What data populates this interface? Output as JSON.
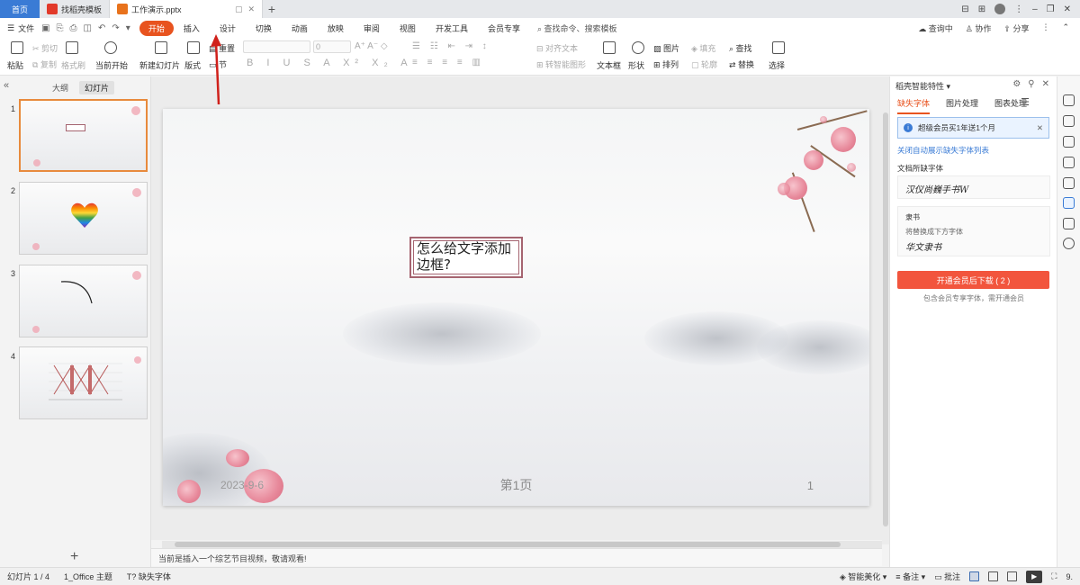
{
  "titlebar": {
    "home_tab": "首页",
    "tabs": [
      {
        "label": "找稻壳模板",
        "icon": "daoke-logo-icon"
      },
      {
        "label": "工作演示.pptx",
        "icon": "presentation-file-icon"
      }
    ],
    "add_tab": "+"
  },
  "menubar": {
    "file_label": "文件",
    "items": [
      "开始",
      "插入",
      "设计",
      "切换",
      "动画",
      "放映",
      "审阅",
      "视图",
      "开发工具",
      "会员专享"
    ],
    "active_item": "开始",
    "search_placeholder": "查找命令、搜索模板",
    "right": {
      "query": "查询中",
      "collab": "协作",
      "share": "分享"
    }
  },
  "ribbon": {
    "paste": "粘贴",
    "cut": "剪切",
    "copy": "复制",
    "format_painter": "格式刷",
    "from_current": "当前开始",
    "new_slide": "新建幻灯片",
    "layout": "版式",
    "section": "节",
    "reset": "重置",
    "font_size": "0",
    "align_text": "对齐文本",
    "smart_shape": "转智能图形",
    "textbox": "文本框",
    "shape": "形状",
    "picture": "图片",
    "fill": "填充",
    "arrange": "排列",
    "outline": "轮廓",
    "find": "查找",
    "replace": "替换",
    "select": "选择"
  },
  "left_panel": {
    "tabs": [
      "大纲",
      "幻灯片"
    ],
    "active_tab": "幻灯片",
    "thumbnails": [
      {
        "number": "1",
        "selected": true
      },
      {
        "number": "2",
        "selected": false
      },
      {
        "number": "3",
        "selected": false
      },
      {
        "number": "4",
        "selected": false
      }
    ],
    "add_label": "+"
  },
  "slide": {
    "textbox_line1": "怎么给文字添加",
    "textbox_line2": "边框?",
    "date": "2023-9-6",
    "footer": "第1页",
    "number": "1"
  },
  "notes": {
    "text": "当前是插入一个综艺节目视频，敬请观看!"
  },
  "right_panel": {
    "title": "稻壳智能特性",
    "tabs": [
      "缺失字体",
      "图片处理",
      "图表处理"
    ],
    "active_tab": "缺失字体",
    "banner": "超级会员买1年送1个月",
    "link": "关闭自动展示缺失字体列表",
    "missing_fonts_label": "文档所缺字体",
    "font_card_1_sample": "汉仪尚巍手书W",
    "font_card_2_name": "隶书",
    "font_card_2_hint": "将替换成下方字体",
    "font_card_2_sample": "华文隶书",
    "download_button": "开通会员后下载 ( 2 )",
    "note": "包含会员专享字体，需开通会员"
  },
  "statusbar": {
    "slide_info": "幻灯片 1 / 4",
    "theme": "1_Office 主题",
    "missing_font": "缺失字体",
    "beautify": "智能美化",
    "notes": "备注",
    "comments": "批注",
    "zoom_short": "9."
  },
  "colors": {
    "accent": "#e8531f",
    "home_tab": "#3a7bd5",
    "download_button": "#f2553d",
    "textbox_border": "#a56470",
    "arrow": "#d0211b"
  }
}
